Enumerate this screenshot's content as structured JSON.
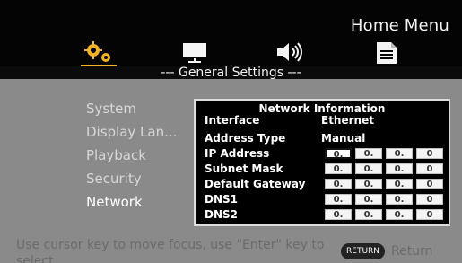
{
  "header": {
    "title": "Home Menu"
  },
  "tabs": [
    {
      "icon": "settings-icon",
      "selected": true
    },
    {
      "icon": "display-icon",
      "selected": false
    },
    {
      "icon": "speaker-icon",
      "selected": false
    },
    {
      "icon": "document-icon",
      "selected": false
    }
  ],
  "section": {
    "title": "--- General Settings ---"
  },
  "menu": {
    "items": [
      "System",
      "Display Lan...",
      "Playback",
      "Security",
      "Network"
    ],
    "active_index": 4
  },
  "panel": {
    "title": "Network Information",
    "interface_label": "Interface",
    "interface_value": "Ethernet",
    "address_type_label": "Address Type",
    "address_type_value": "Manual",
    "fields": [
      {
        "label": "IP Address",
        "octets": [
          "0.",
          "0.",
          "0.",
          "0"
        ]
      },
      {
        "label": "Subnet Mask",
        "octets": [
          "0.",
          "0.",
          "0.",
          "0"
        ]
      },
      {
        "label": "Default Gateway",
        "octets": [
          "0.",
          "0.",
          "0.",
          "0"
        ]
      },
      {
        "label": "DNS1",
        "octets": [
          "0.",
          "0.",
          "0.",
          "0"
        ]
      },
      {
        "label": "DNS2",
        "octets": [
          "0.",
          "0.",
          "0.",
          "0"
        ]
      }
    ]
  },
  "footer": {
    "hint": "Use cursor key to move focus, use \"Enter\" key to select.",
    "return_button": "RETURN",
    "return_text": "Return"
  },
  "colors": {
    "accent": "#f0b429",
    "background": "#8a8a8a",
    "panel": "#000000"
  }
}
